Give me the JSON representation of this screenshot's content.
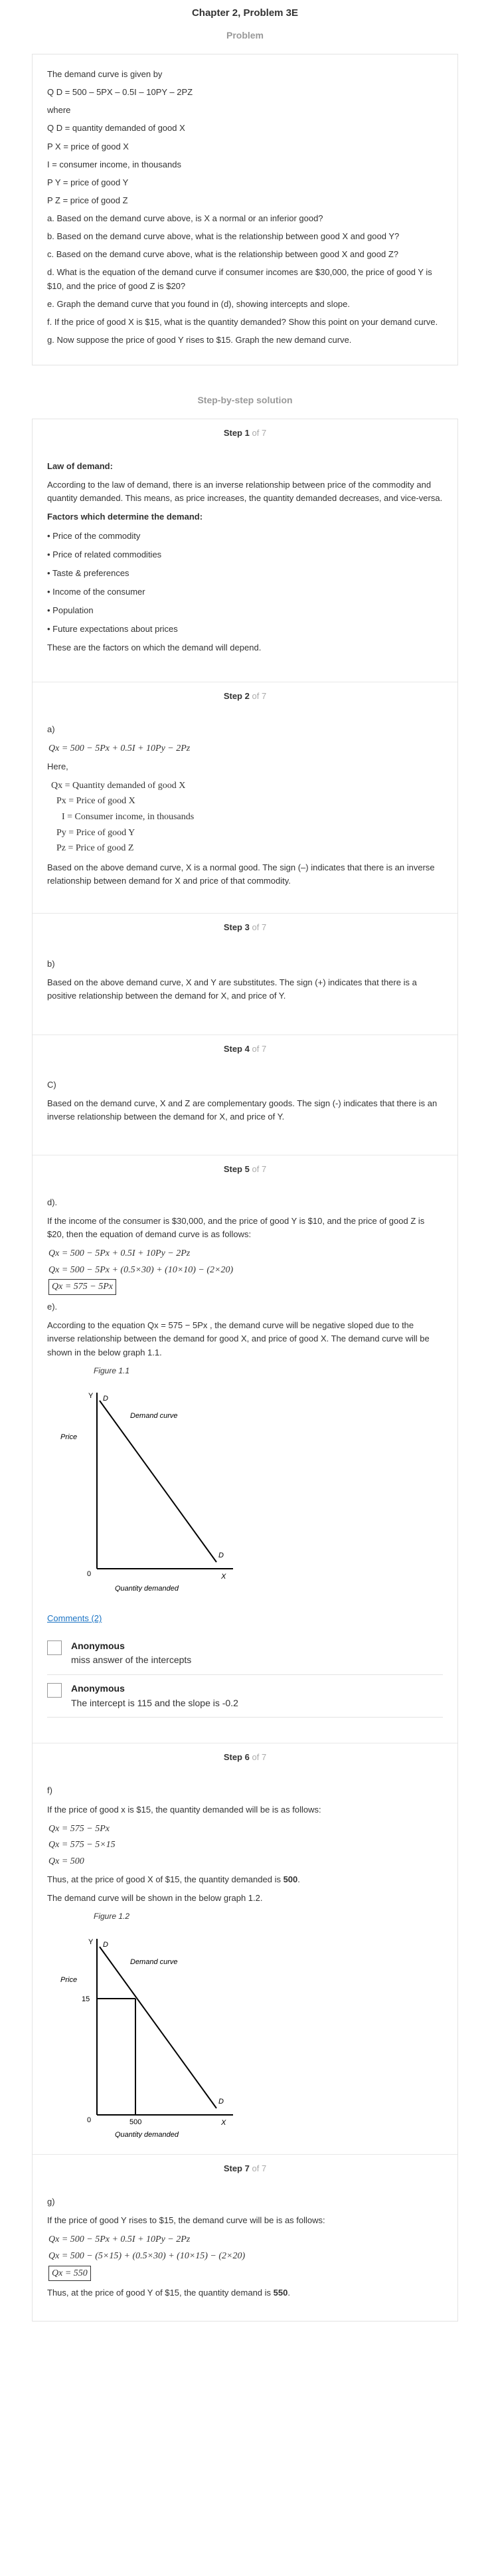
{
  "chapter_title": "Chapter 2, Problem 3E",
  "problem_section_title": "Problem",
  "problem": {
    "lines": [
      "The demand curve is given by",
      "Q D = 500 – 5PX – 0.5I – 10PY – 2PZ",
      "where",
      "Q D = quantity demanded of good X",
      "P X = price of good X",
      "I = consumer income, in thousands",
      "P Y = price of good Y",
      "P Z = price of good Z",
      "a. Based on the demand curve above, is X a normal or an inferior good?",
      "b. Based on the demand curve above, what is the relationship between good X and good Y?",
      "c. Based on the demand curve above, what is the relationship between good X and good Z?",
      "d. What is the equation of the demand curve if consumer incomes are $30,000, the price of good Y is $10, and the price of good Z is $20?",
      "e. Graph the demand curve that you found in (d), showing intercepts and slope.",
      "f. If the price of good X is $15, what is the quantity demanded? Show this point on your demand curve.",
      "g. Now suppose the price of good Y rises to $15. Graph the new demand curve."
    ]
  },
  "solution_section_title": "Step-by-step solution",
  "step_label": "Step",
  "step_of": "of 7",
  "step1": {
    "number": "1",
    "heading1": "Law of demand:",
    "para1": "According to the law of demand, there is an inverse relationship between price of the commodity and quantity demanded. This means, as price increases, the quantity demanded decreases, and vice-versa.",
    "heading2": "Factors which determine the demand:",
    "bullets": [
      "• Price of the commodity",
      "• Price of related commodities",
      "• Taste & preferences",
      "• Income of the consumer",
      "• Population",
      "• Future expectations about prices"
    ],
    "para2": "These are the factors on which the demand will depend."
  },
  "step2": {
    "number": "2",
    "label": "a)",
    "equation": "Qx = 500 − 5Px + 0.5I + 10Py − 2Pz",
    "here": "Here,",
    "defs": [
      "Qx = Quantity demanded of good X",
      "Px = Price of good X",
      "I = Consumer income, in thousands",
      "Py = Price of good Y",
      "Pz = Price of good Z"
    ],
    "para": "Based on the above demand curve, X is a normal good. The sign (–) indicates that there is an inverse relationship between demand for X and price of that commodity."
  },
  "step3": {
    "number": "3",
    "label": "b)",
    "para": "Based on the above demand curve, X and Y are substitutes. The sign (+) indicates that there is a positive relationship between the demand for X, and price of Y."
  },
  "step4": {
    "number": "4",
    "label": "C)",
    "para": "Based on the demand curve, X and Z are complementary goods. The sign (-) indicates that there is an inverse relationship between the demand for X, and price of Y."
  },
  "step5": {
    "number": "5",
    "label_d": "d).",
    "para_d": "If the income of the consumer is $30,000, and the price of good Y is $10, and the price of good Z is $20, then the equation of demand curve is as follows:",
    "eq1": "Qx = 500 − 5Px + 0.5I + 10Py − 2Pz",
    "eq2": "Qx = 500 − 5Px + (0.5×30) + (10×10) − (2×20)",
    "eq3": "Qx = 575 − 5Px",
    "label_e": "e).",
    "para_e": "According to the equation Qx = 575 − 5Px , the demand curve will be negative sloped due to the inverse relationship between the demand for good X, and price of good X. The demand curve will be shown in the below graph 1.1.",
    "figure": {
      "caption": "Figure 1.1",
      "y_axis": "Y",
      "x_axis": "X",
      "y_label": "Price",
      "x_label": "Quantity demanded",
      "origin": "0",
      "curve_label": "Demand curve",
      "top_point": "D",
      "bottom_point": "D"
    },
    "comments_link": "Comments (2)",
    "comments": [
      {
        "author": "Anonymous",
        "text": "miss answer of the intercepts"
      },
      {
        "author": "Anonymous",
        "text": "The intercept is 115 and the slope is -0.2"
      }
    ]
  },
  "step6": {
    "number": "6",
    "label": "f)",
    "para1": "If the price of good x is $15, the quantity demanded will be is as follows:",
    "eq1": "Qx = 575 − 5Px",
    "eq2": "Qx = 575 − 5×15",
    "eq3": "Qx = 500",
    "para2_pre": "Thus, at the price of good X of $15, the quantity demanded is ",
    "para2_bold": "500",
    "para2_post": ".",
    "para3": "The demand curve will be shown in the below graph 1.2.",
    "figure": {
      "caption": "Figure 1.2",
      "y_axis": "Y",
      "x_axis": "X",
      "y_label": "Price",
      "x_label": "Quantity demanded",
      "origin": "0",
      "curve_label": "Demand curve",
      "top_point": "D",
      "bottom_point": "D",
      "price_tick": "15",
      "qty_tick": "500"
    }
  },
  "step7": {
    "number": "7",
    "label": "g)",
    "para1": "If the price of good Y rises to $15, the demand curve will be is as follows:",
    "eq1": "Qx = 500 − 5Px + 0.5I + 10Py − 2Pz",
    "eq2": "Qx = 500 − (5×15) + (0.5×30) + (10×15) − (2×20)",
    "eq3": "Qx = 550",
    "para2_pre": "Thus, at the price of good Y of $15, the quantity demand is ",
    "para2_bold": "550",
    "para2_post": "."
  }
}
